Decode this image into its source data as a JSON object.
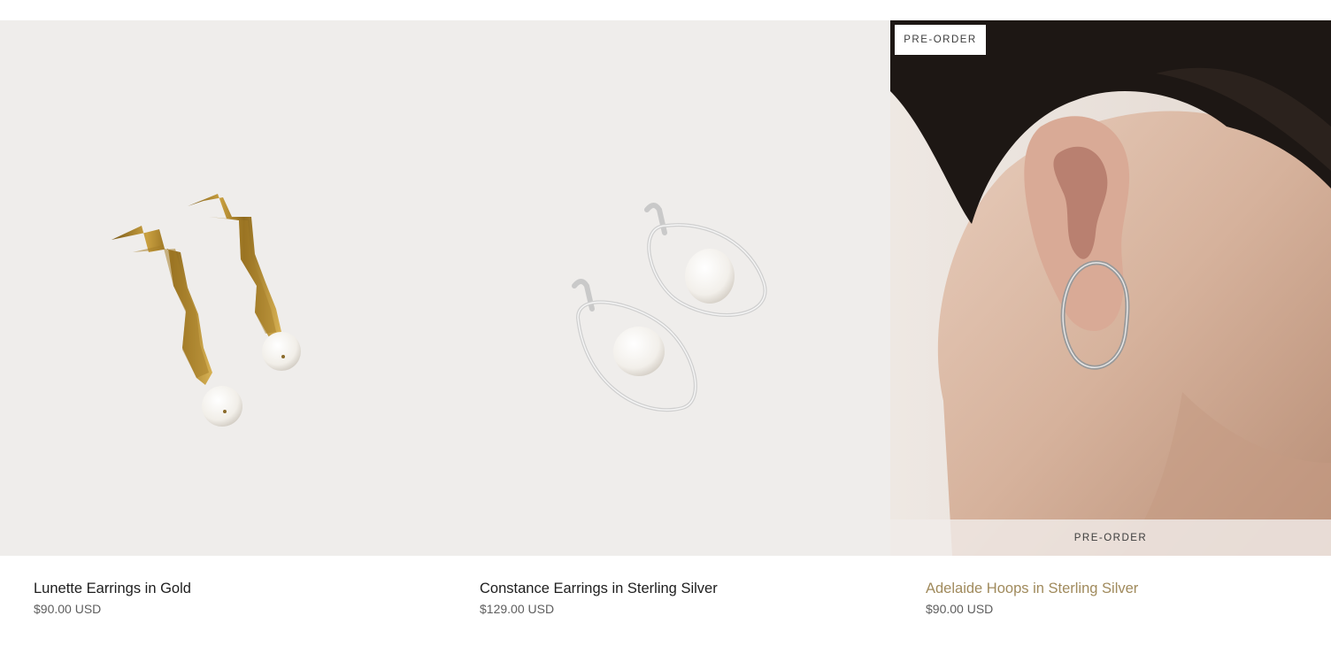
{
  "products": [
    {
      "title": "Lunette Earrings in Gold",
      "price": "$90.00 USD",
      "image_icon": "gold-wavy-pearl-earrings-photo"
    },
    {
      "title": "Constance Earrings in Sterling Silver",
      "price": "$129.00 USD",
      "image_icon": "silver-oval-pearl-earrings-photo"
    },
    {
      "title": "Adelaide Hoops in Sterling Silver",
      "price": "$90.00 USD",
      "badge": "PRE-ORDER",
      "quick_action": "PRE-ORDER",
      "image_icon": "model-wearing-silver-hoop-photo"
    }
  ],
  "colors": {
    "page_bg": "#ffffff",
    "media_bg": "#efedeb",
    "title_text": "#1e1e1e",
    "title_hover": "#a08a5c",
    "price_text": "#5e5e5e"
  }
}
